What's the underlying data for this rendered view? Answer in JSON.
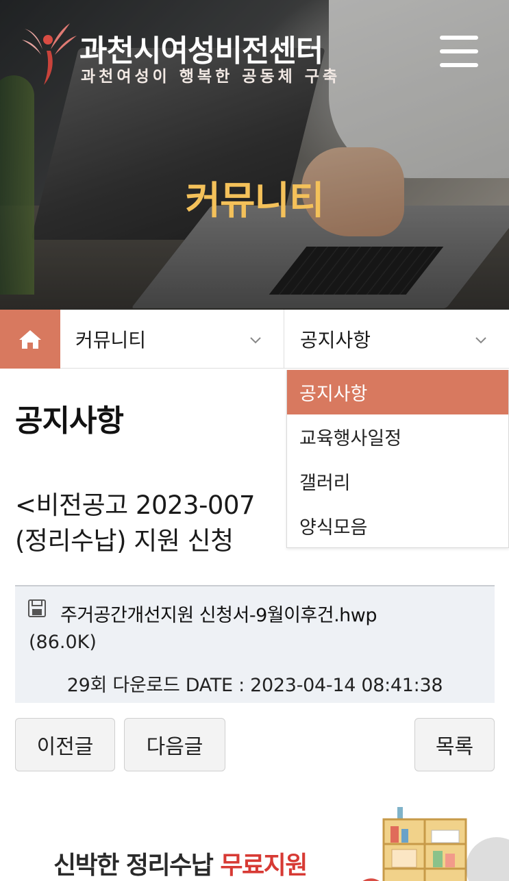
{
  "header": {
    "org_name": "과천시여성비전센터",
    "org_slogan": "과천여성이 행복한 공동체 구축",
    "menu_icon": "hamburger-menu-icon"
  },
  "hero": {
    "title": "커뮤니티"
  },
  "subnav": {
    "home_icon": "home-icon",
    "level1_label": "커뮤니티",
    "level2_label": "공지사항"
  },
  "dropdown": {
    "items": [
      {
        "label": "공지사항",
        "active": true
      },
      {
        "label": "교육행사일정",
        "active": false
      },
      {
        "label": "갤러리",
        "active": false
      },
      {
        "label": "양식모음",
        "active": false
      }
    ]
  },
  "page": {
    "title": "공지사항",
    "post_title_line1": "<비전공고 2023-007",
    "post_title_line2": "(정리수납) 지원 신청 "
  },
  "attachment": {
    "file_name": "주거공간개선지원 신청서-9월이후건.hwp",
    "file_size": "(86.0K)",
    "meta": "29회 다운로드 DATE : 2023-04-14 08:41:38"
  },
  "buttons": {
    "prev": "이전글",
    "next": "다음글",
    "list": "목록"
  },
  "banner": {
    "text_part1": "신박한 정리수납 ",
    "text_highlight": "무료지원"
  },
  "colors": {
    "accent": "#d8795f",
    "hero_title": "#f4c15a",
    "banner_highlight": "#d73a34"
  }
}
